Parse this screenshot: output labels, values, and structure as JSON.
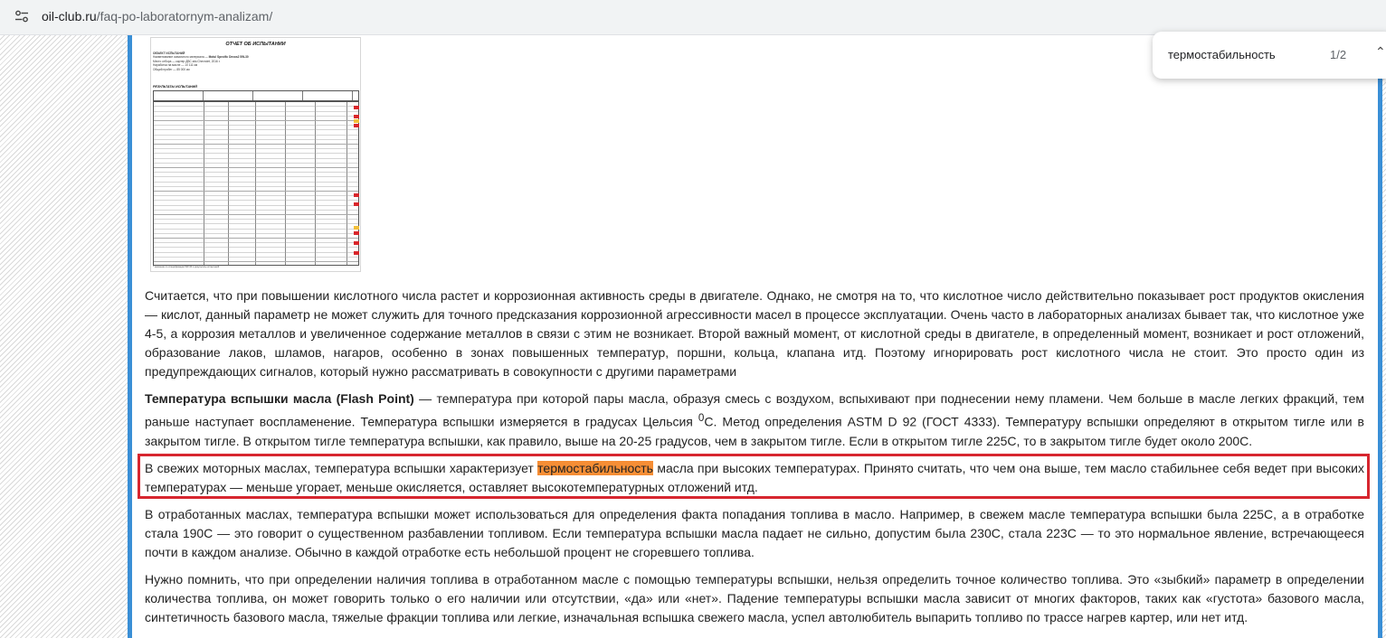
{
  "browser": {
    "url_host": "oil-club.ru",
    "url_path": "/faq-po-laboratornym-analizam/"
  },
  "find_bar": {
    "query": "термостабильность",
    "count": "1/2"
  },
  "report_image": {
    "title": "ОТЧЕТ ОБ ИСПЫТАНИИ",
    "object_label": "ОБЪЕКТ ИСПЫТАНИЙ",
    "product_label": "Наименование смазочного материала",
    "product_value": "Motul Specific Dexos2 5W-30",
    "meta_lines": [
      "Место отбора — картер ДВС а/м Chevrolet, 2016 г.",
      "Наработка на масле — 10 111 км",
      "Общий пробег — 85 000 км"
    ],
    "results_label": "РЕЗУЛЬТАТЫ ИСПЫТАНИЙ",
    "footer": "* значение по спецификации 5W-30 и результаты испытаний"
  },
  "paragraphs": {
    "p1": "Считается, что при повышении кислотного числа растет и коррозионная активность среды в двигателе. Однако, не смотря на то, что кислотное число действительно показывает рост продуктов окисления — кислот, данный параметр не может служить для точного предсказания коррозионной агрессивности масел в процессе эксплуатации. Очень часто в лабораторных анализах бывает так, что кислотное уже 4-5, а коррозия металлов и увеличенное содержание металлов в связи с этим не возникает. Второй важный момент, от кислотной среды в двигателе, в определенный момент, возникает и рост отложений, образование лаков, шламов, нагаров, особенно в зонах повышенных температур, поршни, кольца, клапана итд. Поэтому игнорировать рост кислотного числа не стоит. Это просто один из предупреждающих сигналов, который нужно рассматривать в совокупности с другими параметрами",
    "p2_bold": "Температура вспышки масла (Flash Point)",
    "p2_a": " — температура при которой пары масла, образуя смесь с воздухом, вспыхивают при поднесении нему пламени. Чем больше в масле легких фракций, тем раньше наступает воспламенение. Температура вспышки измеряется в градусах Цельсия ",
    "p2_sup": "0",
    "p2_b": "С. Метод определения ASTM D 92 (ГОСТ 4333). Температуру вспышки определяют в открытом тигле или в закрытом тигле. В открытом тигле температура вспышки, как правило, выше на 20-25 градусов, чем в закрытом тигле. Если в открытом тигле 225С, то в закрытом тигле будет около 200С.",
    "p3_a": "В свежих моторных маслах, температура вспышки характеризует ",
    "p3_hl": "термостабильность",
    "p3_b": " масла при высоких температурах. Принято считать, что чем она выше, тем масло стабильнее себя ведет при высоких температурах — меньше угорает, меньше окисляется, оставляет высокотемпературных отложений итд.",
    "p4": "В отработанных маслах, температура вспышки может использоваться для определения факта попадания топлива в масло. Например, в свежем масле температура вспышки была 225С, а в отработке стала 190С — это говорит о существенном разбавлении топливом. Если температура вспышки масла падает не сильно, допустим была 230С, стала 223С — то это нормальное явление, встречающееся почти в каждом анализе. Обычно в каждой отработке есть небольшой процент не сгоревшего топлива.",
    "p5": "Нужно помнить, что при определении наличия топлива в отработанном масле с помощью температуры вспышки, нельзя определить точное количество топлива. Это «зыбкий» параметр в определении количества топлива, он может говорить только о его наличии или отсутствии, «да» или «нет». Падение температуры вспышки масла зависит от многих факторов, таких как «густота» базового масла, синтетичность базового масла, тяжелые фракции топлива или легкие, изначальная вспышка свежего масла, успел автолюбитель выпарить топливо по трассе нагрев картер, или нет итд."
  },
  "colors": {
    "highlight": "#f68e35",
    "annotation_box": "#d7262f",
    "side_bar": "#3a8fd6"
  }
}
